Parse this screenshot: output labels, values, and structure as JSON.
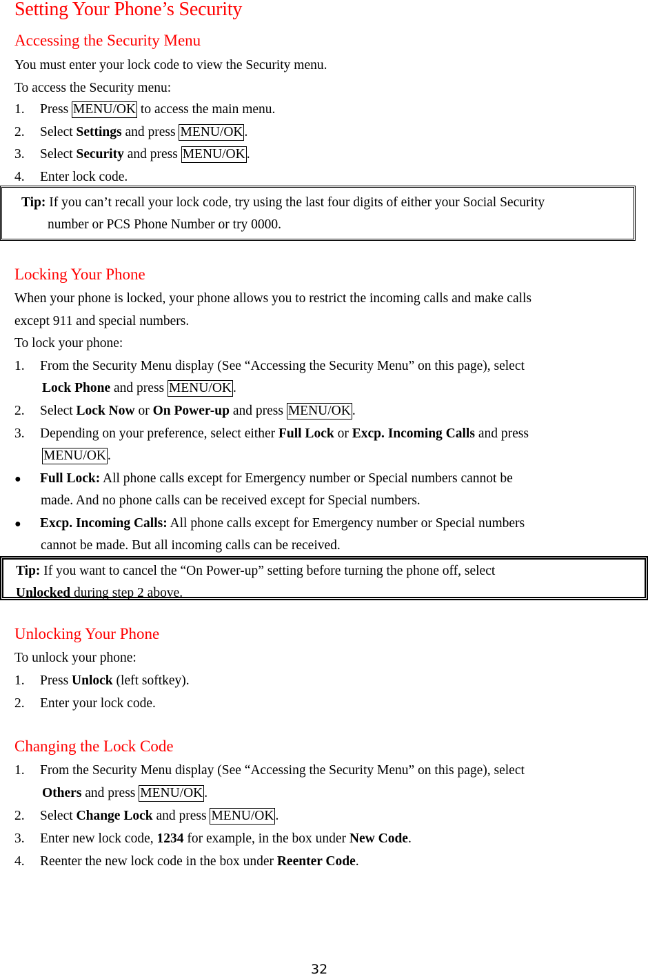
{
  "title": "Setting Your Phone’s Security",
  "sections": {
    "accessing": {
      "heading": "Accessing the Security Menu",
      "intro": "You must enter your lock code to view the Security menu.",
      "lead": "To access the Security menu:",
      "steps": [
        {
          "num": "1.",
          "a": "Press ",
          "key": "MENU/OK",
          "b": " to access the main menu."
        },
        {
          "num": "2.",
          "a": "Select ",
          "bold": "Settings",
          "b": " and press ",
          "key": "MENU/OK",
          "c": "."
        },
        {
          "num": "3.",
          "a": "Select ",
          "bold": "Security",
          "b": " and press ",
          "key": "MENU/OK",
          "c": "."
        },
        {
          "num": "4.",
          "a": "Enter lock code."
        }
      ],
      "tip": {
        "label": "Tip:",
        "line1": " If you can’t recall your lock code, try using the last four digits of either your Social Security",
        "line2": "number or PCS Phone Number or try 0000."
      }
    },
    "locking": {
      "heading": "Locking Your Phone",
      "intro1": "When your phone is locked, your phone allows you to restrict the incoming calls and make calls",
      "intro2": "except 911 and special numbers.",
      "lead": "To lock your phone:",
      "step1": {
        "num": "1.",
        "line1": "From the Security Menu display (See “Accessing the Security Menu” on this page), select",
        "bold": "Lock Phone",
        "a": " and press ",
        "key": "MENU/OK",
        "b": "."
      },
      "step2": {
        "num": "2.",
        "a": "Select ",
        "bold1": "Lock Now",
        "b": " or ",
        "bold2": "On Power-up",
        "c": " and press ",
        "key": "MENU/OK",
        "d": "."
      },
      "step3": {
        "num": "3.",
        "a": "Depending on your preference, select either ",
        "bold1": "Full Lock",
        "b": " or ",
        "bold2": "Excp. Incoming Calls",
        "c": " and press",
        "key": "MENU/OK",
        "d": "."
      },
      "bullets": [
        {
          "bullet": "●",
          "bold": "Full Lock:",
          "line1": " All phone calls except for Emergency number or Special numbers cannot be",
          "line2": "made. And no phone calls can be received except for Special numbers."
        },
        {
          "bullet": "●",
          "bold": "Excp. Incoming Calls:",
          "line1": " All phone calls except for Emergency number or Special numbers",
          "line2": "cannot be made. But all incoming calls can be received."
        }
      ],
      "tip": {
        "label": "Tip:",
        "line1": " If you want to cancel the “On Power-up” setting before turning the phone off, select",
        "bold": "Unlocked",
        "line2": " during step 2 above."
      }
    },
    "unlocking": {
      "heading": "Unlocking Your Phone",
      "lead": "To unlock your phone:",
      "step1": {
        "num": "1.",
        "a": "Press ",
        "bold": "Unlock",
        "b": " (left softkey)."
      },
      "step2": {
        "num": "2.",
        "a": "Enter your lock code."
      }
    },
    "changing": {
      "heading": "Changing the Lock Code",
      "step1": {
        "num": "1.",
        "line1": "From the Security Menu display (See “Accessing the Security Menu” on this page), select",
        "bold": "Others",
        "a": " and press ",
        "key": "MENU/OK",
        "b": "."
      },
      "step2": {
        "num": "2.",
        "a": "Select ",
        "bold": "Change Lock",
        "b": " and press ",
        "key": "MENU/OK",
        "c": "."
      },
      "step3": {
        "num": "3.",
        "a": "Enter new lock code, ",
        "bold1": "1234",
        "b": " for example, in the box under ",
        "bold2": "New Code",
        "c": "."
      },
      "step4": {
        "num": "4.",
        "a": "Reenter the new lock code in the box under ",
        "bold": "Reenter Code",
        "b": "."
      }
    }
  },
  "page_number": "32",
  "colors": {
    "heading": "#ff0000",
    "text": "#000000"
  }
}
